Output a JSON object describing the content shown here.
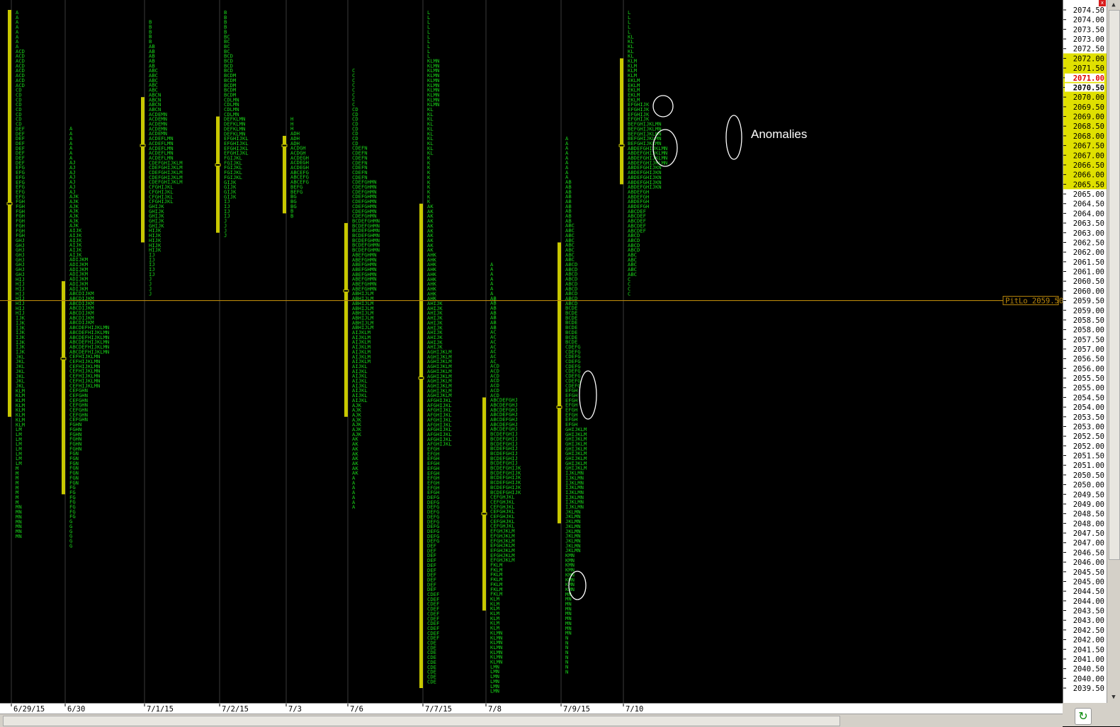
{
  "chart_data": {
    "type": "market-profile",
    "price_axis": {
      "max": 2074.5,
      "min": 2039.5,
      "step": 0.5,
      "highlighted_levels": [
        "2072.00",
        "2071.50",
        "2071.00",
        "2070.50",
        "2070.00",
        "2069.50",
        "2069.00",
        "2068.50",
        "2068.00",
        "2067.50",
        "2067.00",
        "2066.50",
        "2066.00",
        "2065.50"
      ],
      "current_price": "2071.00",
      "marked_price": "2070.50"
    },
    "reference_line": {
      "label": "PitLo 2059.50",
      "price": 2059.5,
      "color": "#b8860b"
    },
    "sessions": [
      {
        "date": "6/29/15",
        "high": 2074.5,
        "low": 2047.0,
        "value_high": 2074.5,
        "value_low": 2053.5,
        "poc": 2064.5,
        "letters": [
          "A",
          "ACD",
          "CD",
          "DEF",
          "EFG",
          "FGH",
          "GHJ",
          "HIJ",
          "IJK",
          "JKL",
          "KLM",
          "LM",
          "M",
          "MN"
        ]
      },
      {
        "date": "6/30",
        "high": 2068.5,
        "low": 2046.5,
        "value_high": 2060.5,
        "value_low": 2049.5,
        "poc": 2056.5,
        "letters": [
          "A",
          "AJ",
          "AJK",
          "AIJK",
          "ADIJKM",
          "ABCDIJKM",
          "ABCDEFHIJKLMN",
          "CEFHIJKLMN",
          "CEFGHN",
          "FGHN",
          "FGN",
          "FG",
          "G"
        ]
      },
      {
        "date": "7/1/15",
        "high": 2074.0,
        "low": 2059.5,
        "value_high": 2070.0,
        "value_low": 2062.5,
        "poc": 2067.5,
        "letters": [
          "B",
          "AB",
          "ABC",
          "ABCN",
          "ACDEMN",
          "ACDEFLMN",
          "CDEFGHIJKLM",
          "CFGHIJKL",
          "GHIJK",
          "HIJK",
          "IJ",
          "J"
        ]
      },
      {
        "date": "7/2/15",
        "high": 2074.5,
        "low": 2062.5,
        "value_high": 2069.0,
        "value_low": 2063.0,
        "poc": 2066.5,
        "letters": [
          "B",
          "BC",
          "BCD",
          "BCDM",
          "CDLMN",
          "DEFKLMN",
          "EFGHIJKL",
          "FGIJKL",
          "GIJK",
          "IJ",
          "J"
        ]
      },
      {
        "date": "7/3",
        "high": 2069.0,
        "low": 2063.5,
        "value_high": 2068.0,
        "value_low": 2064.0,
        "poc": 2067.5,
        "letters": [
          "H",
          "ADH",
          "ACDGH",
          "ACDEGH",
          "ABCEFG",
          "BEFG",
          "BG",
          "B"
        ]
      },
      {
        "date": "7/6",
        "high": 2071.5,
        "low": 2048.5,
        "value_high": 2063.5,
        "value_low": 2053.5,
        "poc": 2060.0,
        "letters": [
          "C",
          "CD",
          "CDEFN",
          "CDEFGHMN",
          "BCDEFGHMN",
          "ABEFGHMN",
          "ABHIJLM",
          "AIJKLM",
          "AIJKL",
          "AJK",
          "AK",
          "A"
        ]
      },
      {
        "date": "7/7/15",
        "high": 2074.5,
        "low": 2039.5,
        "value_high": 2064.5,
        "value_low": 2039.5,
        "poc": 2055.5,
        "letters": [
          "L",
          "KLMN",
          "KL",
          "K",
          "AK",
          "AHK",
          "AHIJK",
          "AGHIJKLM",
          "AFGHIJKL",
          "EFGH",
          "DEFG",
          "DEF",
          "CDEF",
          "CDE"
        ]
      },
      {
        "date": "7/8",
        "high": 2061.5,
        "low": 2039.0,
        "value_high": 2054.5,
        "value_low": 2043.5,
        "poc": 2048.5,
        "letters": [
          "A",
          "AB",
          "AC",
          "ACD",
          "ABCDEFGHJ",
          "BCDEFGHIJ",
          "BCDEFGHIJK",
          "CEFGHJKL",
          "EFGHJKLM",
          "FKLM",
          "KLM",
          "KLMN",
          "LMN"
        ]
      },
      {
        "date": "7/9/15",
        "high": 2068.0,
        "low": 2040.0,
        "value_high": 2062.5,
        "value_low": 2048.0,
        "poc": 2054.0,
        "letters": [
          "A",
          "AB",
          "ABC",
          "ABCD",
          "BCDE",
          "CDEFG",
          "EFGH",
          "GHIJKLM",
          "IJKLMN",
          "JKLMN",
          "KMN",
          "MN",
          "N"
        ]
      },
      {
        "date": "7/10",
        "high": 2074.5,
        "low": 2059.5,
        "value_high": 2072.0,
        "value_low": 2065.5,
        "poc": 2067.5,
        "letters": [
          "L",
          "KL",
          "KLM",
          "EKLM",
          "EFGHIJK",
          "BEFGHIJKLMN",
          "ABDEFGHIJKLMN",
          "ABDEFGHIJKN",
          "ABDEFGH",
          "ABCDEF",
          "ABCD",
          "ABC",
          "C"
        ]
      }
    ],
    "annotation": {
      "label": "Anomalies"
    }
  }
}
